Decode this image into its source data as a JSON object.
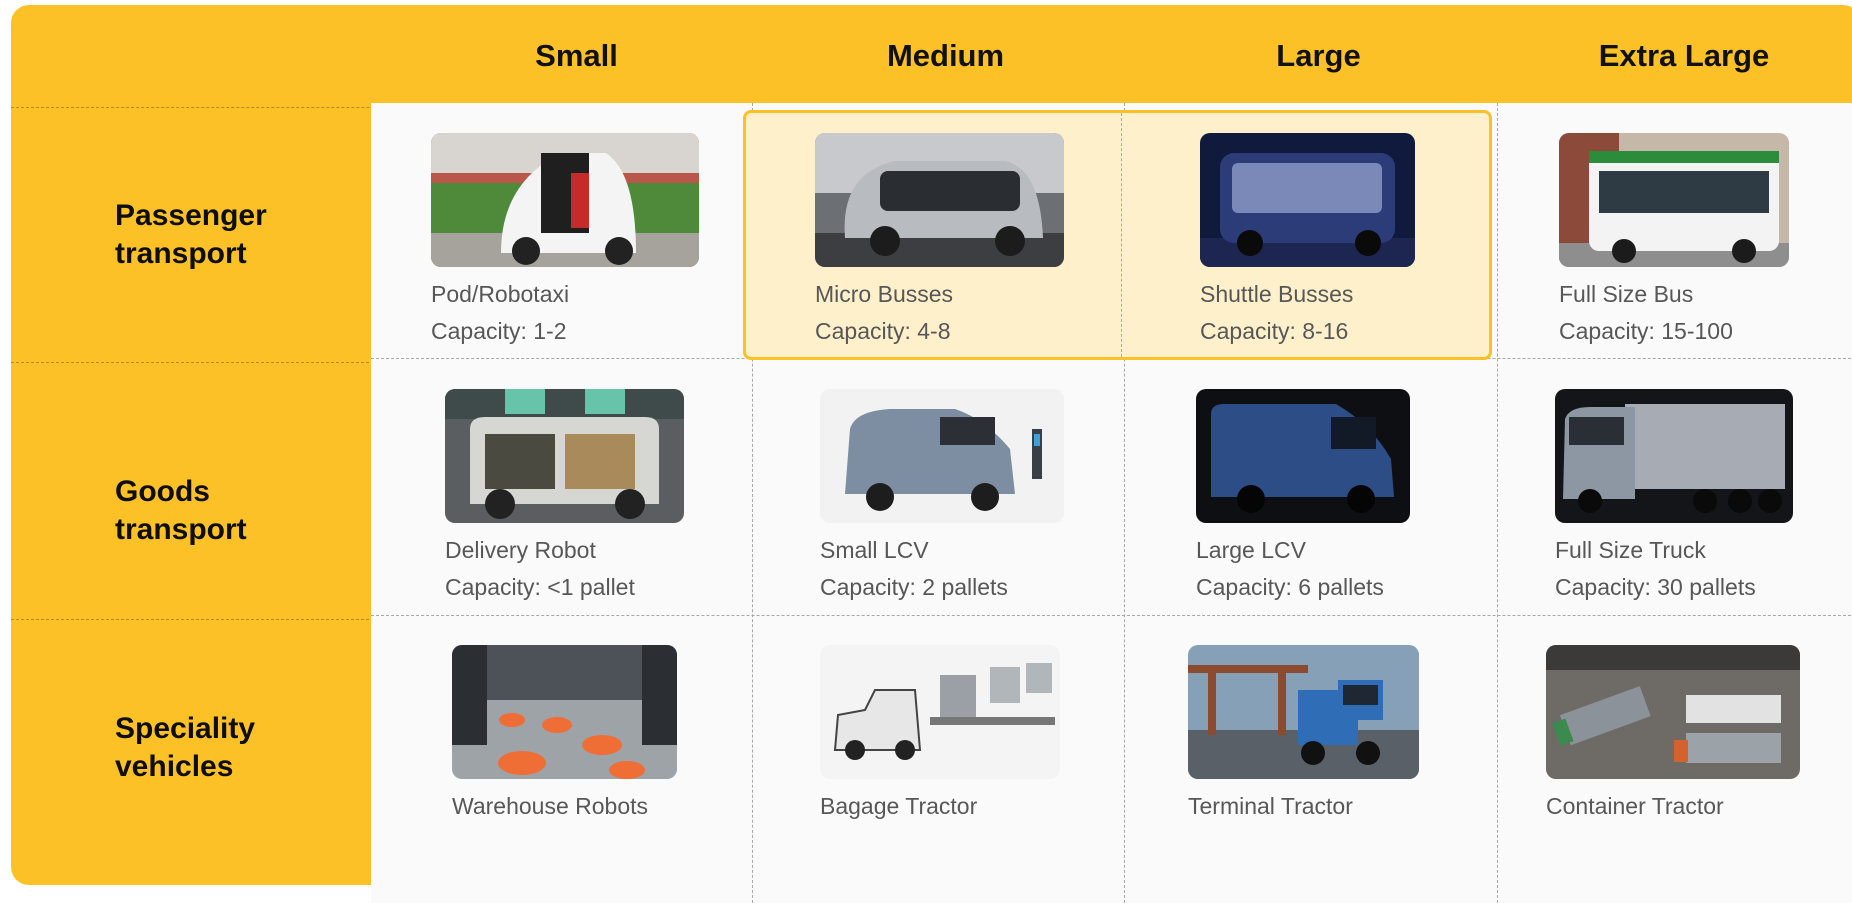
{
  "columns": [
    "Small",
    "Medium",
    "Large",
    "Extra Large"
  ],
  "rows": [
    {
      "label_line1": "Passenger",
      "label_line2": "transport",
      "vehicles": [
        {
          "name": "Pod/Robotaxi",
          "capacity": "Capacity: 1-2"
        },
        {
          "name": "Micro Busses",
          "capacity": "Capacity: 4-8"
        },
        {
          "name": "Shuttle Busses",
          "capacity": "Capacity: 8-16"
        },
        {
          "name": "Full Size Bus",
          "capacity": "Capacity: 15-100"
        }
      ]
    },
    {
      "label_line1": "Goods",
      "label_line2": "transport",
      "vehicles": [
        {
          "name": "Delivery Robot",
          "capacity": "Capacity: <1 pallet"
        },
        {
          "name": "Small LCV",
          "capacity": "Capacity: 2 pallets"
        },
        {
          "name": "Large LCV",
          "capacity": "Capacity: 6 pallets"
        },
        {
          "name": "Full Size Truck",
          "capacity": "Capacity: 30 pallets"
        }
      ]
    },
    {
      "label_line1": "Speciality",
      "label_line2": "vehicles",
      "vehicles": [
        {
          "name": "Warehouse Robots",
          "capacity": ""
        },
        {
          "name": "Bagage Tractor",
          "capacity": ""
        },
        {
          "name": "Terminal Tractor",
          "capacity": ""
        },
        {
          "name": "Container Tractor",
          "capacity": ""
        }
      ]
    }
  ],
  "highlighted_cells": [
    "Micro Busses",
    "Shuttle Busses"
  ],
  "colors": {
    "accent_yellow": "#fcc126",
    "highlight_fill": "#fff0cc",
    "cell_background": "#fafafa"
  }
}
